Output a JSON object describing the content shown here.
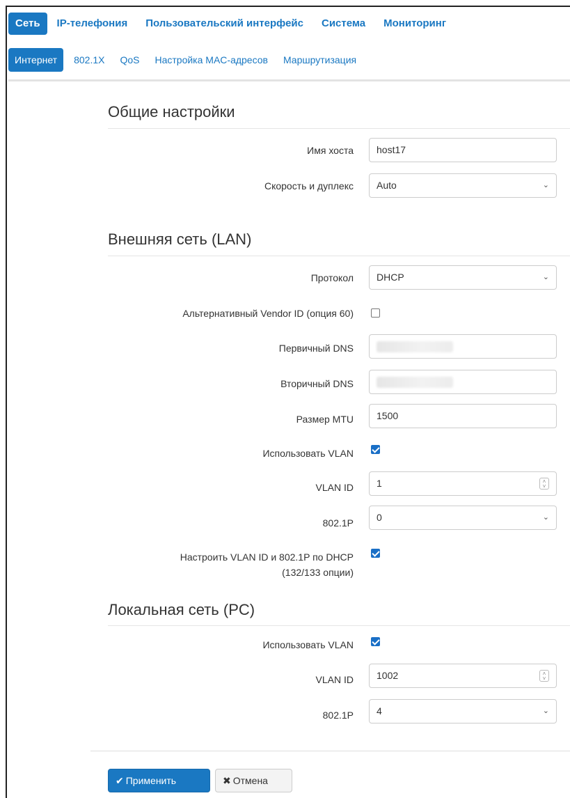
{
  "topnav": [
    "Сеть",
    "IP-телефония",
    "Пользовательский интерфейс",
    "Система",
    "Мониторинг"
  ],
  "subnav": [
    "Интернет",
    "802.1X",
    "QoS",
    "Настройка MAC-адресов",
    "Маршрутизация"
  ],
  "sections": {
    "general": {
      "title": "Общие настройки",
      "hostname_label": "Имя хоста",
      "hostname_value": "host17",
      "speed_label": "Скорость и дуплекс",
      "speed_value": "Auto"
    },
    "wan": {
      "title": "Внешняя сеть (LAN)",
      "protocol_label": "Протокол",
      "protocol_value": "DHCP",
      "vendor_label": "Альтернативный Vendor ID (опция 60)",
      "vendor_checked": false,
      "dns1_label": "Первичный DNS",
      "dns2_label": "Вторичный DNS",
      "mtu_label": "Размер MTU",
      "mtu_value": "1500",
      "vlan_label": "Использовать VLAN",
      "vlan_checked": true,
      "vlanid_label": "VLAN ID",
      "vlanid_value": "1",
      "p8021_label": "802.1P",
      "p8021_value": "0",
      "dhcp_vlan_label_line1": "Настроить VLAN ID и 802.1P по DHCP",
      "dhcp_vlan_label_line2": "(132/133 опции)",
      "dhcp_vlan_checked": true
    },
    "lan": {
      "title": "Локальная сеть (PC)",
      "vlan_label": "Использовать VLAN",
      "vlan_checked": true,
      "vlanid_label": "VLAN ID",
      "vlanid_value": "1002",
      "p8021_label": "802.1P",
      "p8021_value": "4"
    }
  },
  "buttons": {
    "apply_icon": "checkmark-icon",
    "apply_label": "Применить",
    "cancel_icon": "x-icon",
    "cancel_label": "Отмена"
  },
  "colors": {
    "accent": "#1a78c2",
    "checkbox": "#1a6fc6"
  }
}
